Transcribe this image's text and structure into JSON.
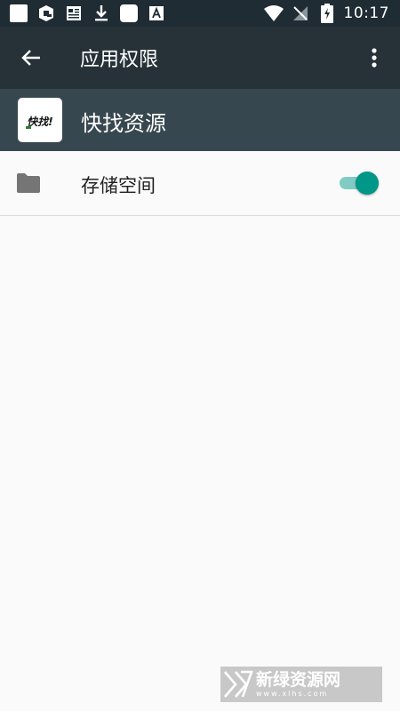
{
  "status_bar": {
    "time": "10:17",
    "left_icons": [
      "square-notification-icon",
      "qr-app-icon",
      "news-icon",
      "download-icon",
      "square-notification-icon",
      "a-app-icon"
    ],
    "right_icons": [
      "wifi-icon",
      "no-signal-icon",
      "battery-charging-icon"
    ]
  },
  "toolbar": {
    "title": "应用权限",
    "back_icon": "arrow-back-icon",
    "more_icon": "more-vert-icon"
  },
  "app": {
    "name": "快找资源",
    "icon_text": "快找!"
  },
  "permissions": [
    {
      "label": "存储空间",
      "icon": "folder-icon",
      "enabled": true
    }
  ],
  "watermark": {
    "text": "新绿资源网",
    "sub": "www.xlhs.com"
  },
  "colors": {
    "status_bar": "#1f2c34",
    "toolbar": "#263238",
    "app_header": "#37474f",
    "switch_on": "#009688",
    "switch_track": "#80cbc4",
    "background": "#fafafa"
  }
}
